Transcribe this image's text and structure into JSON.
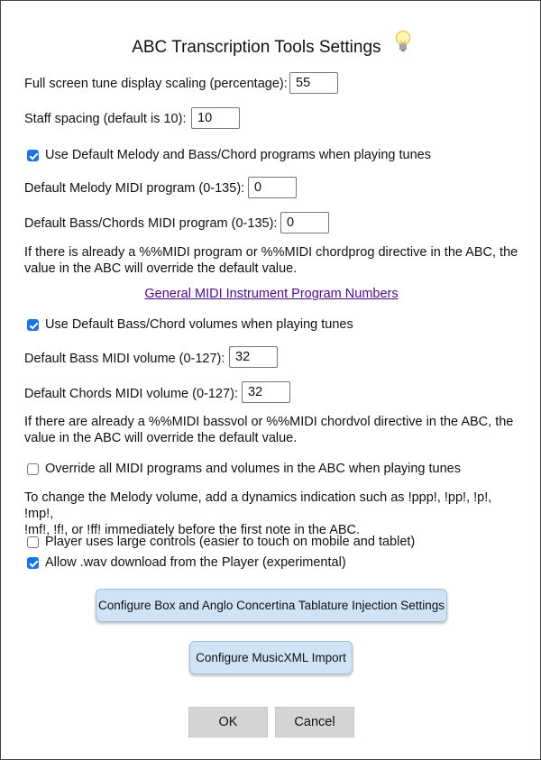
{
  "dialog": {
    "title": "ABC Transcription Tools Settings",
    "title_icon": "lightbulb-icon"
  },
  "fields": {
    "scaling": {
      "label": "Full screen tune display scaling (percentage):",
      "value": "55"
    },
    "staff_spacing": {
      "label": "Staff spacing (default is 10):",
      "value": "10"
    },
    "melody_program": {
      "label": "Default Melody MIDI program (0-135):",
      "value": "0"
    },
    "bass_program": {
      "label": "Default Bass/Chords MIDI program (0-135):",
      "value": "0"
    },
    "bass_volume": {
      "label": "Default Bass MIDI volume (0-127):",
      "value": "32"
    },
    "chords_volume": {
      "label": "Default Chords MIDI volume (0-127):",
      "value": "32"
    }
  },
  "checkboxes": {
    "use_default_programs": {
      "label": "Use Default Melody and Bass/Chord programs when playing tunes",
      "checked": true
    },
    "use_default_volumes": {
      "label": "Use Default Bass/Chord volumes when playing tunes",
      "checked": true
    },
    "override_all": {
      "label": "Override all MIDI programs and volumes in the ABC when playing tunes",
      "checked": false
    },
    "large_controls": {
      "label": "Player uses large controls (easier to touch on mobile and tablet)",
      "checked": false
    },
    "allow_wav": {
      "label": "Allow .wav download from the Player (experimental)",
      "checked": true
    }
  },
  "notes": {
    "program_note_1": "If there is already a %%MIDI program or %%MIDI chordprog directive in the ABC, the",
    "program_note_2": "value in the ABC will override the default value.",
    "volume_note_1": "If there are already a %%MIDI bassvol or %%MIDI chordvol directive in the ABC, the",
    "volume_note_2": "value in the ABC will override the default value.",
    "melody_note_1": "To change the Melody volume, add a dynamics indication such as !ppp!, !pp!, !p!, !mp!,",
    "melody_note_2": "!mf!, !f!, or !ff! immediately before the first note in the ABC."
  },
  "link": {
    "text": "General MIDI Instrument Program Numbers"
  },
  "buttons": {
    "concertina": "Configure Box and Anglo Concertina Tablature Injection Settings",
    "musicxml": "Configure MusicXML Import",
    "ok": "OK",
    "cancel": "Cancel"
  },
  "colors": {
    "checkbox_checked": "#1a73e8",
    "link": "#4b0a8a",
    "config_button_bg": "#cfe3f5",
    "dialog_button_bg": "#d4d4d4"
  }
}
